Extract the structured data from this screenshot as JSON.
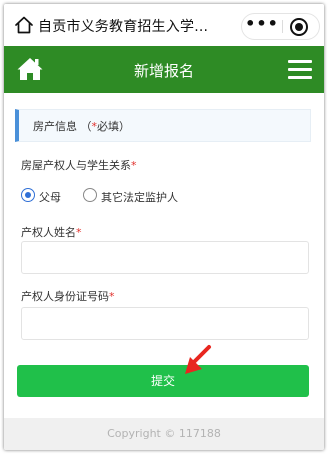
{
  "topbar": {
    "title": "自贡市义务教育招生入学...",
    "more_label": "•••"
  },
  "header": {
    "title": "新增报名"
  },
  "section": {
    "title": "房产信息 （",
    "required_mark": "*",
    "title_suffix": "必填）"
  },
  "relation": {
    "label": "房屋产权人与学生关系",
    "required_mark": "*",
    "options": [
      {
        "label": "父母",
        "selected": true
      },
      {
        "label": "其它法定监护人",
        "selected": false
      }
    ]
  },
  "owner_name": {
    "label": "产权人姓名",
    "required_mark": "*",
    "value": "",
    "placeholder": ""
  },
  "owner_id": {
    "label": "产权人身份证号码",
    "required_mark": "*",
    "value": "",
    "placeholder": ""
  },
  "submit": {
    "label": "提交"
  },
  "footer": {
    "copyright": "Copyright © 117188"
  },
  "colors": {
    "header_green": "#2e8b25",
    "submit_green": "#20c04a",
    "required_red": "#e0302b",
    "radio_blue": "#2f6fd6",
    "accent_blue": "#4a90d9",
    "arrow_red": "#e8261f"
  },
  "icons": {
    "topbar_home": "home-outline-icon",
    "header_home": "home-icon",
    "menu": "hamburger-menu-icon",
    "target": "target-icon",
    "pointer": "red-arrow-icon"
  }
}
